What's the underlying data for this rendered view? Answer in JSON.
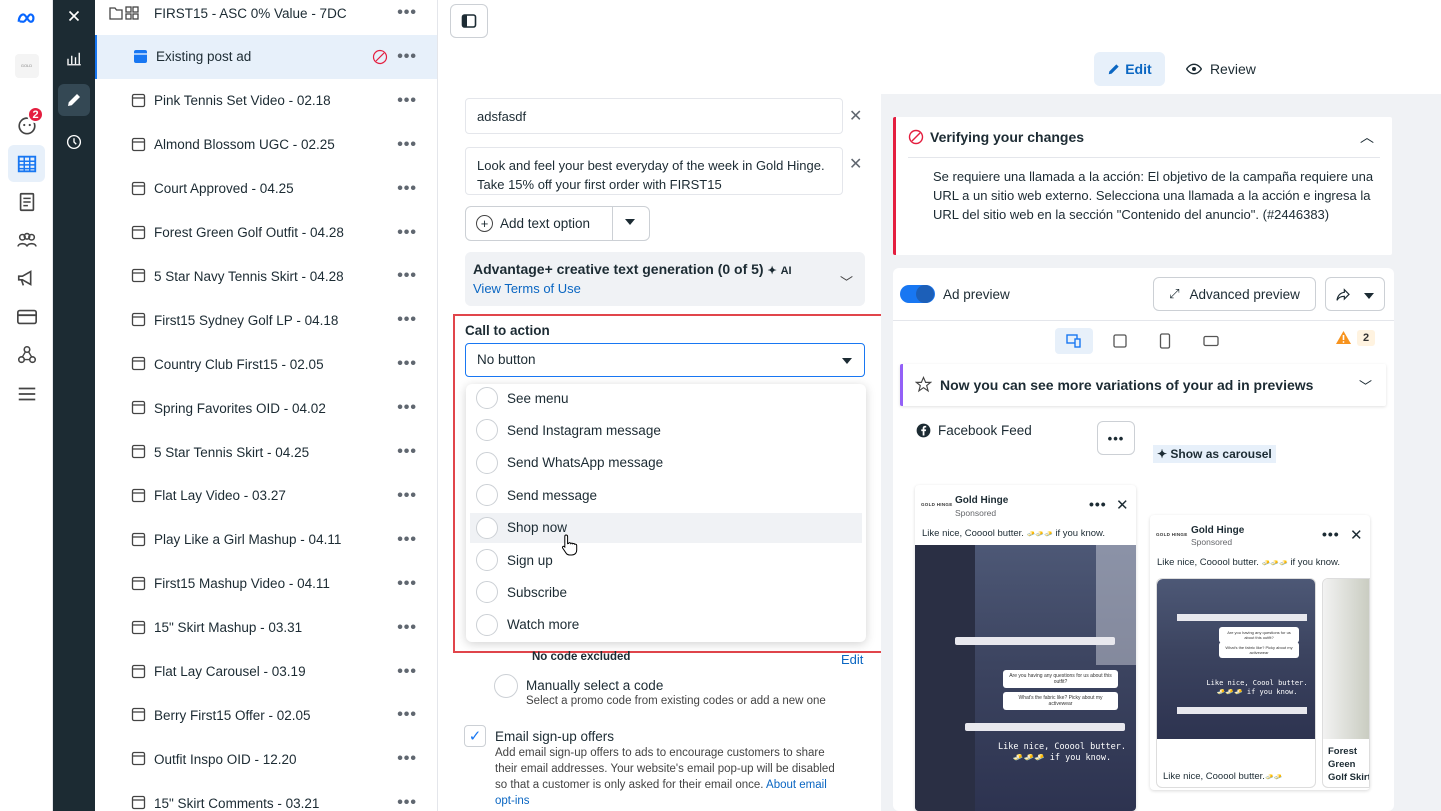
{
  "rail": {
    "notification_count": "2"
  },
  "tree": {
    "items": [
      {
        "label": "FIRST15 - ASC 0% Value - 7DC",
        "type": "folder"
      },
      {
        "label": "Existing post ad",
        "type": "ad",
        "selected": true
      },
      {
        "label": "Pink Tennis Set Video - 02.18",
        "type": "ad"
      },
      {
        "label": "Almond Blossom UGC - 02.25",
        "type": "ad"
      },
      {
        "label": "Court Approved - 04.25",
        "type": "ad"
      },
      {
        "label": "Forest Green Golf Outfit - 04.28",
        "type": "ad"
      },
      {
        "label": "5 Star Navy Tennis Skirt - 04.28",
        "type": "ad"
      },
      {
        "label": "First15 Sydney Golf LP - 04.18",
        "type": "ad"
      },
      {
        "label": "Country Club First15 - 02.05",
        "type": "ad"
      },
      {
        "label": "Spring Favorites OID - 04.02",
        "type": "ad"
      },
      {
        "label": "5 Star Tennis Skirt - 04.25",
        "type": "ad"
      },
      {
        "label": "Flat Lay Video - 03.27",
        "type": "ad"
      },
      {
        "label": "Play Like a Girl Mashup - 04.11",
        "type": "ad"
      },
      {
        "label": "First15 Mashup Video - 04.11",
        "type": "ad"
      },
      {
        "label": "15\" Skirt Mashup - 03.31",
        "type": "ad"
      },
      {
        "label": "Flat Lay Carousel - 03.19",
        "type": "ad"
      },
      {
        "label": "Berry First15 Offer - 02.05",
        "type": "ad"
      },
      {
        "label": "Outfit Inspo OID - 12.20",
        "type": "ad"
      },
      {
        "label": "15\" Skirt Comments - 03.21",
        "type": "ad"
      }
    ],
    "more_glyph": "•••"
  },
  "form": {
    "text_option_1": "adsfasdf",
    "text_option_2": "Look and feel your best everyday of the week in Gold Hinge. Take 15% off your first order with FIRST15",
    "add_text_option": "Add text option",
    "advantage_title": "Advantage+ creative text generation (0 of 5)",
    "advantage_ai": "AI",
    "advantage_link": "View Terms of Use",
    "cta_label": "Call to action",
    "cta_value": "No button",
    "cta_options": [
      "See menu",
      "Send Instagram message",
      "Send WhatsApp message",
      "Send message",
      "Shop now",
      "Sign up",
      "Subscribe",
      "Watch more"
    ],
    "cta_hover_index": 4,
    "no_code_excluded": "No code excluded",
    "edit_link": "Edit",
    "manual_code_title": "Manually select a code",
    "manual_code_desc": "Select a promo code from existing codes or add a new one",
    "email_title": "Email sign-up offers",
    "email_desc_1": "Add email sign-up offers to ads to encourage customers to share",
    "email_desc_2": "their email addresses. Your website's email pop-up will be disabled",
    "email_desc_3": "so that a customer is only asked for their email once.",
    "email_link_1": "About email",
    "email_link_2": "opt-ins"
  },
  "header": {
    "edit": "Edit",
    "review": "Review"
  },
  "verify": {
    "title": "Verifying your changes",
    "body": "Se requiere una llamada a la acción: El objetivo de la campaña requiere una URL a un sitio web externo. Selecciona una llamada a la acción e ingresa la URL del sitio web en la sección \"Contenido del anuncio\". (#2446383)"
  },
  "preview": {
    "ad_preview_label": "Ad preview",
    "advanced_preview": "Advanced preview",
    "warning_count": "2",
    "variations_title": "Now you can see more variations of your ad in previews",
    "placement": "Facebook Feed",
    "show_carousel": "Show as carousel",
    "ad1": {
      "logo": "GOLD HINGE",
      "name": "Gold Hinge",
      "sponsored": "Sponsored",
      "caption": "Like nice, Cooool butter. ",
      "caption_emojis": "🧈🧈🧈",
      "caption_end": " if you know.",
      "bubble1": "Are you having any questions for us about this outfit?",
      "bubble2": "What's the fabric like? Picky about my activewear",
      "overlay1": "Like nice, Cooool butter.",
      "overlay2": "🧈🧈🧈 if you know."
    },
    "ad2": {
      "logo": "GOLD HINGE",
      "name": "Gold Hinge",
      "sponsored": "Sponsored",
      "caption": "Like nice, Cooool butter. ",
      "caption_emojis": "🧈🧈🧈",
      "caption_end": " if you know.",
      "bubble1": "Are you having any questions for us about this outfit?",
      "bubble2": "What's the fabric like? Picky about my activewear",
      "overlay1": "Like nice, Coool butter.",
      "overlay2": "🧈🧈🧈 if you know.",
      "card_caption": "Like nice, Cooool butter.",
      "card_emojis": "🧈🧈",
      "card2_title": "Forest Green Golf Skirt"
    }
  },
  "colors": {
    "accent": "#1877f2",
    "error": "#e41e3f",
    "highlight_box": "#e1454b",
    "dark_nav": "#1c2b33"
  }
}
